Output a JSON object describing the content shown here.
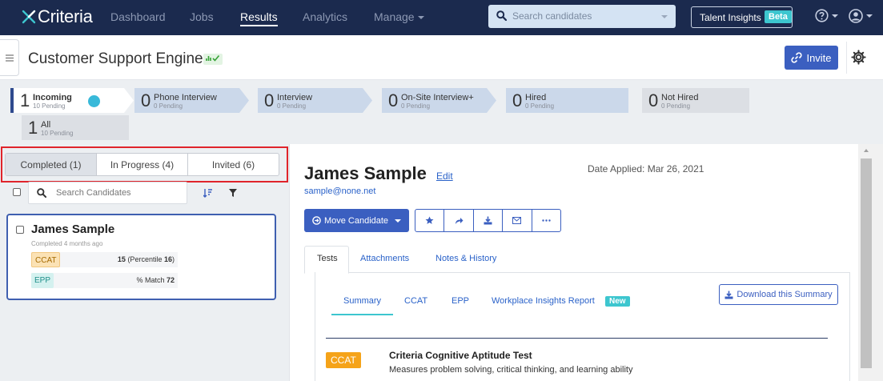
{
  "nav": {
    "logo": "Criteria",
    "links": [
      "Dashboard",
      "Jobs",
      "Results",
      "Analytics",
      "Manage"
    ],
    "active": "Results",
    "search_placeholder": "Search candidates",
    "talent_insights": "Talent Insights",
    "beta": "Beta"
  },
  "header": {
    "job_title": "Customer Support Engineer",
    "invite": "Invite"
  },
  "pipeline": {
    "stages": [
      {
        "count": "1",
        "name": "Incoming",
        "sub": "10 Pending"
      },
      {
        "count": "0",
        "name": "Phone Interview",
        "sub": "0 Pending"
      },
      {
        "count": "0",
        "name": "Interview",
        "sub": "0 Pending"
      },
      {
        "count": "0",
        "name": "On-Site Interview+",
        "sub": "0 Pending"
      },
      {
        "count": "0",
        "name": "Hired",
        "sub": "0 Pending"
      },
      {
        "count": "0",
        "name": "Not Hired",
        "sub": "0 Pending"
      },
      {
        "count": "1",
        "name": "All",
        "sub": "10 Pending"
      }
    ]
  },
  "left": {
    "tabs": [
      "Completed (1)",
      "In Progress (4)",
      "Invited (6)"
    ],
    "search_placeholder": "Search Candidates",
    "card": {
      "name": "James Sample",
      "sub": "Completed 4 months ago",
      "ccat_label": "CCAT",
      "ccat_score": "15",
      "ccat_pct_label": "(Percentile",
      "ccat_pct": "16",
      "epp_label": "EPP",
      "epp_text": "% Match",
      "epp_match": "72"
    }
  },
  "candidate": {
    "name": "James Sample",
    "edit": "Edit",
    "email": "sample@none.net",
    "date_applied": "Date Applied: Mar 26, 2021",
    "move": "Move Candidate"
  },
  "tabs": [
    "Tests",
    "Attachments",
    "Notes & History"
  ],
  "subtabs": [
    "Summary",
    "CCAT",
    "EPP",
    "Workplace Insights Report"
  ],
  "new_badge": "New",
  "download": "Download this Summary",
  "test": {
    "badge": "CCAT",
    "title": "Criteria Cognitive Aptitude Test",
    "desc": "Measures problem solving, critical thinking, and learning ability"
  }
}
